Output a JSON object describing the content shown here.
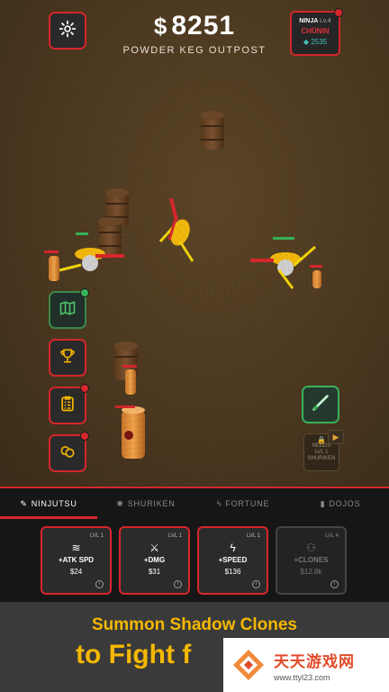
{
  "hud": {
    "currency_symbol": "$",
    "money": "8251",
    "location": "POWDER KEG OUTPOST",
    "player": {
      "ninja": "NINJA",
      "level": "Lv.4",
      "rank": "CHŪNIN",
      "gems": "2535"
    }
  },
  "side_buttons": [
    "map",
    "trophy",
    "clipboard",
    "coins"
  ],
  "special": {
    "locked_text": [
      "NEEDS",
      "LVL 1",
      "SHURIKEN"
    ]
  },
  "tabs": [
    {
      "label": "NINJUTSU",
      "active": true
    },
    {
      "label": "SHURIKEN",
      "active": false
    },
    {
      "label": "FORTUNE",
      "active": false
    },
    {
      "label": "DOJOS",
      "active": false
    }
  ],
  "upgrades": [
    {
      "lvl": "LVL 1",
      "name": "+ATK SPD",
      "price": "$24",
      "icon": "wind-icon",
      "locked": false
    },
    {
      "lvl": "LVL 1",
      "name": "+DMG",
      "price": "$31",
      "icon": "sword-icon",
      "locked": false
    },
    {
      "lvl": "LVL 1",
      "name": "+SPEED",
      "price": "$136",
      "icon": "lightning-icon",
      "locked": false
    },
    {
      "lvl": "LVL 4",
      "name": "+CLONES",
      "price": "$12.8k",
      "icon": "users-icon",
      "locked": true
    }
  ],
  "promo": {
    "line1": "Summon Shadow Clones",
    "line2": "to Fight f"
  },
  "watermark": {
    "cn": "天天游戏网",
    "url": "www.ttyl23.com"
  },
  "colors": {
    "accent": "#d7262c",
    "gold": "#f5b800",
    "gem": "#46c7b9",
    "green": "#39b35a"
  }
}
